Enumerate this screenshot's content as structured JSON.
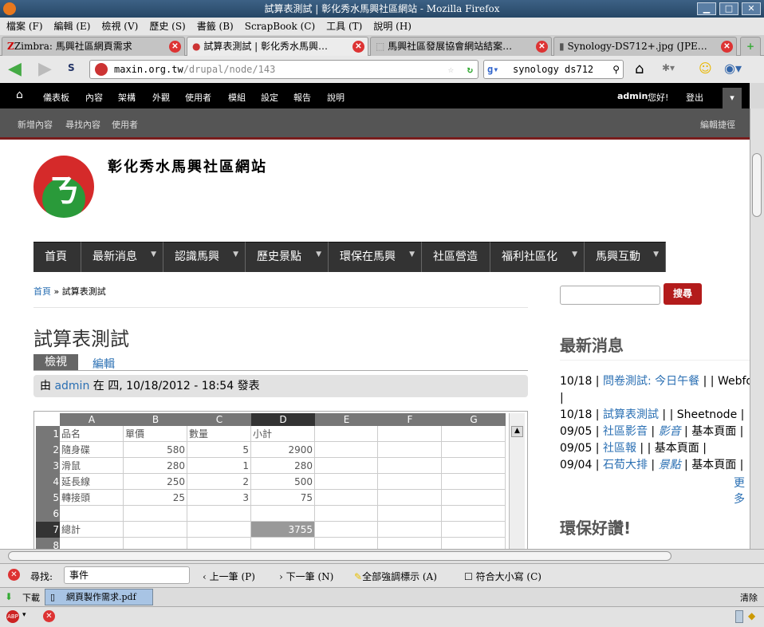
{
  "window": {
    "title": "試算表測試 | 彰化秀水馬興社區網站 - Mozilla Firefox"
  },
  "menu": [
    "檔案 (F)",
    "編輯 (E)",
    "檢視 (V)",
    "歷史 (S)",
    "書籤 (B)",
    "ScrapBook (C)",
    "工具 (T)",
    "說明 (H)"
  ],
  "tabs": [
    {
      "label": "Zimbra: 馬興社區網頁需求"
    },
    {
      "label": "試算表測試 | 彰化秀水馬興…"
    },
    {
      "label": "馬興社區發展協會網站結案…"
    },
    {
      "label": "Synology-DS712+.jpg (JPE…"
    }
  ],
  "nav": {
    "url_host": "maxin.org.tw",
    "url_path": "/drupal/node/143",
    "search_value": "synology ds712"
  },
  "admin": {
    "items": [
      "儀表板",
      "內容",
      "架構",
      "外觀",
      "使用者",
      "模組",
      "設定",
      "報告",
      "說明"
    ],
    "user": "admin",
    "hello": "您好!",
    "logout": "登出"
  },
  "shortcuts": {
    "items": [
      "新增內容",
      "尋找內容",
      "使用者"
    ],
    "edit": "編輯捷徑"
  },
  "site": {
    "name": "彰化秀水馬興社區網站",
    "menu": [
      "首頁",
      "最新消息",
      "認識馬興",
      "歷史景點",
      "環保在馬興",
      "社區營造",
      "福利社區化",
      "馬興互動"
    ]
  },
  "breadcrumb": {
    "home": "首頁",
    "sep": " » ",
    "current": "試算表測試"
  },
  "node": {
    "title": "試算表測試",
    "tabs": [
      "檢視",
      "編輯"
    ],
    "submitted_by": "由 ",
    "author": "admin",
    "submitted_rest": " 在 四, 10/18/2012 - 18:54 發表"
  },
  "sheet": {
    "columns": [
      "A",
      "B",
      "C",
      "D",
      "E",
      "F",
      "G"
    ],
    "row_numbers": [
      "1",
      "2",
      "3",
      "4",
      "5",
      "6",
      "7",
      "8"
    ],
    "rows": [
      [
        "品名",
        "單價",
        "數量",
        "小計"
      ],
      [
        "隨身碟",
        "580",
        "5",
        "2900"
      ],
      [
        "滑鼠",
        "280",
        "1",
        "280"
      ],
      [
        "延長線",
        "250",
        "2",
        "500"
      ],
      [
        "轉接頭",
        "25",
        "3",
        "75"
      ],
      [
        "",
        "",
        "",
        ""
      ],
      [
        "總計",
        "",
        "",
        "3755"
      ],
      [
        "",
        "",
        "",
        ""
      ]
    ]
  },
  "sidebar": {
    "search_button": "搜尋",
    "news_title": "最新消息",
    "news": [
      {
        "date": "10/18",
        "link": "問卷測試: 今日午餐",
        "rest": " | | Webfo"
      },
      {
        "date": "",
        "link": "",
        "rest": "|"
      },
      {
        "date": "10/18",
        "link": "試算表測試",
        "rest": " | | Sheetnode |"
      },
      {
        "date": "09/05",
        "link": "社區影音",
        "tag": "影音",
        "rest": " | 基本頁面 |"
      },
      {
        "date": "09/05",
        "link": "社區報",
        "rest": " | | 基本頁面 |"
      },
      {
        "date": "09/04",
        "link": "石荀大排",
        "tag": "景點",
        "rest": " | 基本頁面 |"
      }
    ],
    "more": "更多",
    "eco_title": "環保好讚!"
  },
  "findbar": {
    "label": "尋找:",
    "value": "事件",
    "prev": "上一筆 (P)",
    "next": "下一筆 (N)",
    "highlight": "全部強調標示 (A)",
    "match_case": "符合大小寫 (C)"
  },
  "downloads": {
    "label": "下載",
    "file": "網頁製作需求.pdf",
    "clear": "清除"
  }
}
